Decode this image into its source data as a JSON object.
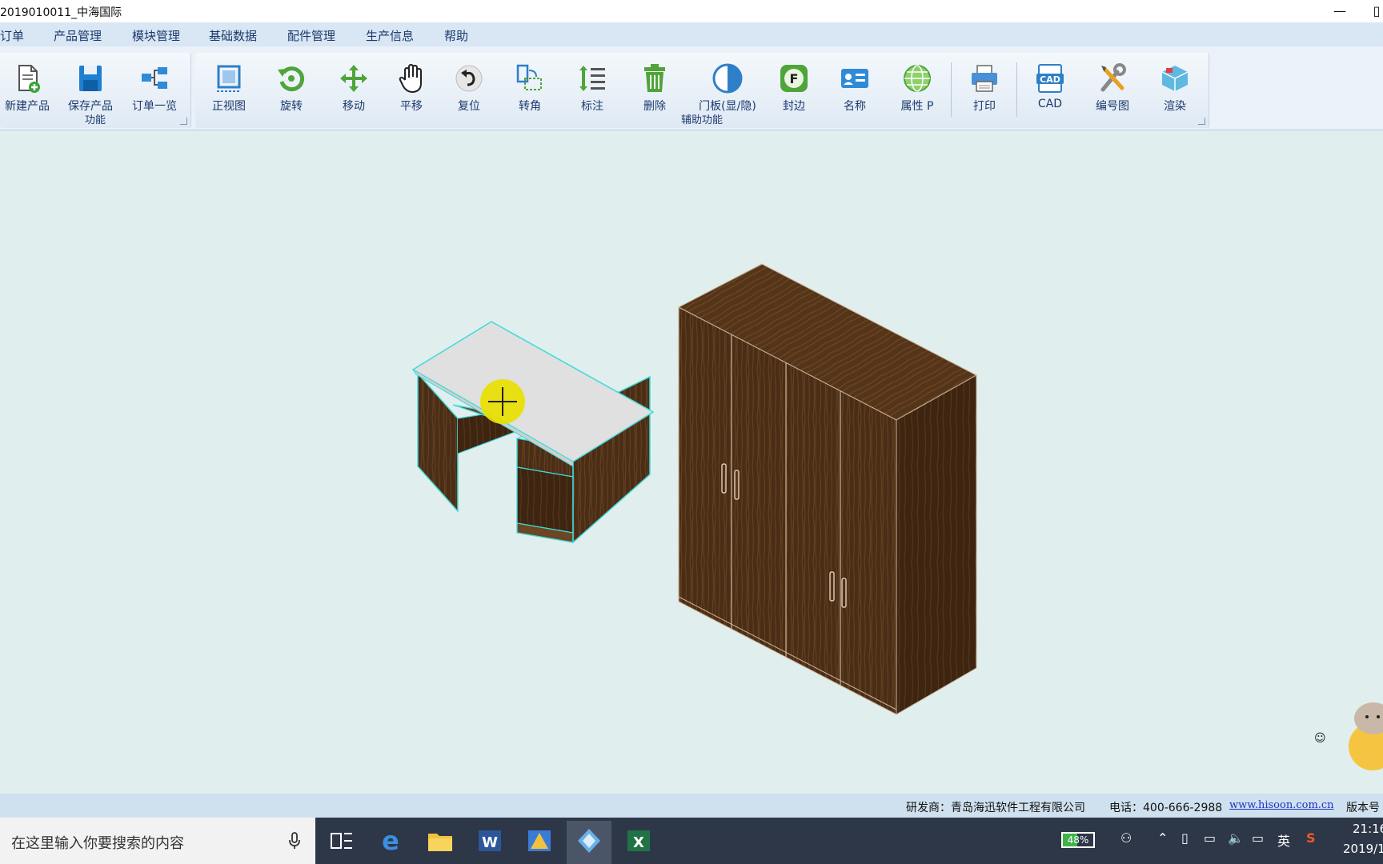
{
  "window": {
    "title": "2019010011_中海国际",
    "minimize_glyph": "—",
    "maximize_glyph": "▯"
  },
  "menu": [
    "订单",
    "产品管理",
    "模块管理",
    "基础数据",
    "配件管理",
    "生产信息",
    "帮助"
  ],
  "ribbon": {
    "group1": {
      "label": "功能",
      "tools": [
        {
          "label": "新建产品",
          "icon": "new-product-icon"
        },
        {
          "label": "保存产品",
          "icon": "save-icon"
        },
        {
          "label": "订单一览",
          "icon": "order-list-icon"
        }
      ]
    },
    "group2": {
      "label": "辅助功能",
      "tools": [
        {
          "label": "正视图",
          "icon": "front-view-icon"
        },
        {
          "label": "旋转",
          "icon": "rotate-icon"
        },
        {
          "label": "移动",
          "icon": "move-icon"
        },
        {
          "label": "平移",
          "icon": "pan-hand-icon"
        },
        {
          "label": "复位",
          "icon": "reset-icon"
        },
        {
          "label": "转角",
          "icon": "corner-icon"
        },
        {
          "label": "标注",
          "icon": "dimension-icon"
        },
        {
          "label": "删除",
          "icon": "trash-icon"
        },
        {
          "label": "门板(显/隐)",
          "icon": "door-toggle-icon"
        },
        {
          "label": "封边",
          "icon": "edge-banding-icon"
        },
        {
          "label": "名称",
          "icon": "name-card-icon"
        },
        {
          "label": "属性 P",
          "icon": "properties-globe-icon"
        },
        {
          "label": "打印",
          "icon": "printer-icon"
        },
        {
          "label": "CAD",
          "icon": "cad-icon"
        },
        {
          "label": "编号图",
          "icon": "tools-icon"
        },
        {
          "label": "渲染",
          "icon": "render-icon"
        }
      ]
    }
  },
  "status": {
    "developer": "研发商：青岛海迅软件工程有限公司",
    "phone": "电话：400-666-2988",
    "website": "www.hisoon.com.cn",
    "version": "版本号"
  },
  "taskbar": {
    "search_placeholder": "在这里输入你要搜索的内容",
    "battery": "48%",
    "ime": "英",
    "time": "21:16",
    "date": "2019/1"
  },
  "colors": {
    "canvas": "#e1eeee",
    "wood": "#4a2d16",
    "selection": "#3fd9d9",
    "cursor": "#e8e000"
  }
}
